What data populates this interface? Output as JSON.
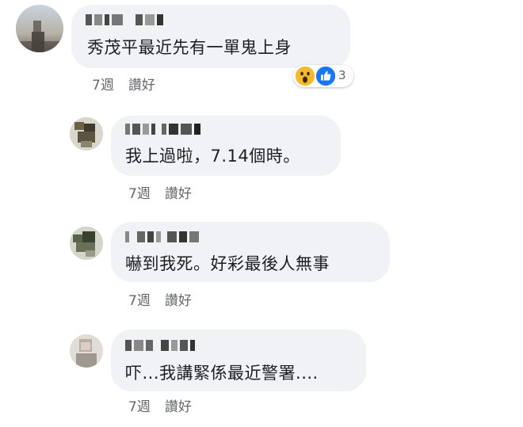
{
  "comments": [
    {
      "text": "秀茂平最近先有一單鬼上身",
      "time": "7週",
      "like_label": "讚好",
      "reaction_count": "3",
      "reactions": [
        "wow-icon",
        "like-icon"
      ]
    },
    {
      "text": "我上過啦，7.14個時。",
      "time": "7週",
      "like_label": "讚好"
    },
    {
      "text": "嚇到我死。好彩最後人無事",
      "time": "7週",
      "like_label": "讚好"
    },
    {
      "text": "吓...我講緊係最近警署....",
      "time": "7週",
      "like_label": "讚好"
    }
  ],
  "colors": {
    "bubble": "#f0f2f5",
    "meta_text": "#65676b",
    "like_blue": "#1877f2",
    "wow_yellow": "#f7b928"
  }
}
